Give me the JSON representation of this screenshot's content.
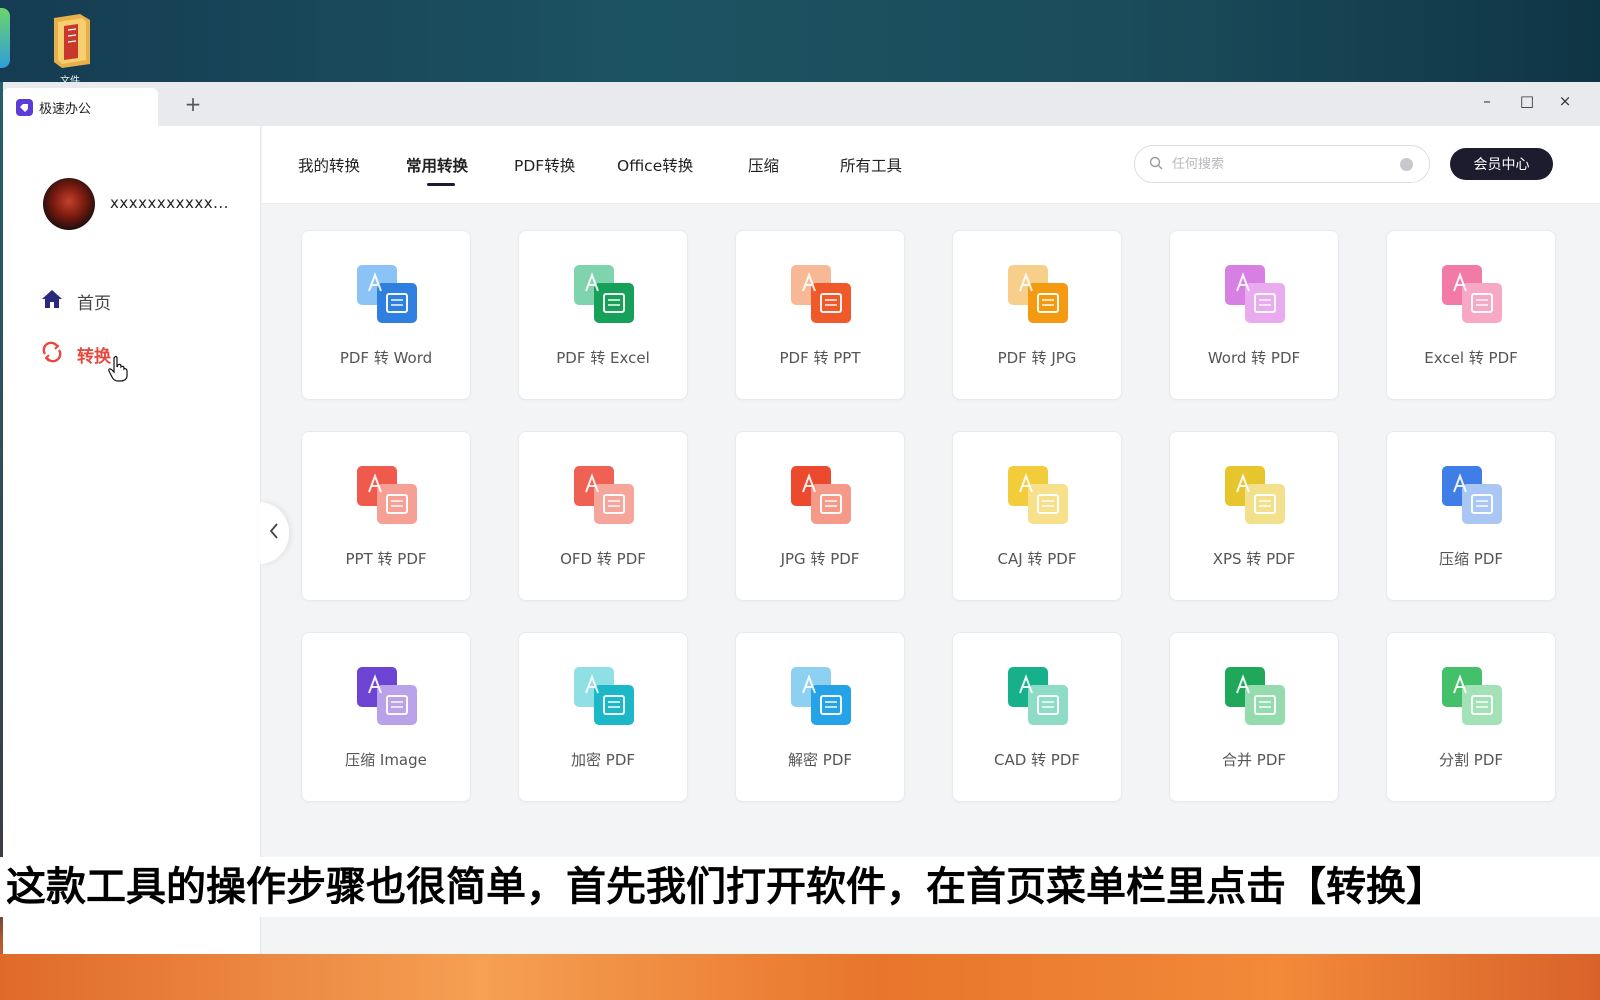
{
  "desktop": {
    "folder_label": "文件"
  },
  "window": {
    "tab_title": "极速办公",
    "new_tab": "+",
    "controls": {
      "minimize": "–",
      "maximize": "□",
      "close": "×"
    }
  },
  "sidebar": {
    "username": "xxxxxxxxxxx...",
    "items": [
      {
        "label": "首页",
        "icon": "home-icon",
        "color": "#2b2a7a"
      },
      {
        "label": "转换",
        "icon": "convert-icon",
        "color": "#e8493e",
        "active": true
      }
    ]
  },
  "topnav": {
    "tabs": [
      {
        "label": "我的转换"
      },
      {
        "label": "常用转换",
        "active": true
      },
      {
        "label": "PDF转换"
      },
      {
        "label": "Office转换"
      },
      {
        "label": "压缩"
      },
      {
        "label": "所有工具"
      }
    ],
    "search_placeholder": "任何搜索",
    "vip_button": "会员中心"
  },
  "tools": [
    {
      "label": "PDF 转 Word",
      "icon": "pdf-to-word-icon",
      "back": "#8cc3f7",
      "front": "#2f7fe0"
    },
    {
      "label": "PDF 转 Excel",
      "icon": "pdf-to-excel-icon",
      "back": "#7fd4ae",
      "front": "#16a05a"
    },
    {
      "label": "PDF 转 PPT",
      "icon": "pdf-to-ppt-icon",
      "back": "#f7b896",
      "front": "#f0592a"
    },
    {
      "label": "PDF 转 JPG",
      "icon": "pdf-to-jpg-icon",
      "back": "#f8cf8a",
      "front": "#f39a10"
    },
    {
      "label": "Word 转 PDF",
      "icon": "word-to-pdf-icon",
      "back": "#d77fe3",
      "front": "#eaaaf0"
    },
    {
      "label": "Excel 转 PDF",
      "icon": "excel-to-pdf-icon",
      "back": "#f27aa6",
      "front": "#f6a8c4"
    },
    {
      "label": "PPT 转 PDF",
      "icon": "ppt-to-pdf-icon",
      "back": "#f05a4c",
      "front": "#f6a095"
    },
    {
      "label": "OFD 转 PDF",
      "icon": "ofd-to-pdf-icon",
      "back": "#ef6154",
      "front": "#f6a59a"
    },
    {
      "label": "JPG 转 PDF",
      "icon": "jpg-to-pdf-icon",
      "back": "#eb4a2e",
      "front": "#f59a88"
    },
    {
      "label": "CAJ 转 PDF",
      "icon": "caj-to-pdf-icon",
      "back": "#f2cc3a",
      "front": "#f7e08a"
    },
    {
      "label": "XPS 转 PDF",
      "icon": "xps-to-pdf-icon",
      "back": "#e7c52d",
      "front": "#f3e08a"
    },
    {
      "label": "压缩 PDF",
      "icon": "compress-pdf-icon",
      "back": "#3e7ee6",
      "front": "#a9c6f4"
    },
    {
      "label": "压缩 Image",
      "icon": "compress-image-icon",
      "back": "#6d43d3",
      "front": "#b9a2ea"
    },
    {
      "label": "加密 PDF",
      "icon": "encrypt-pdf-icon",
      "back": "#8fe0e4",
      "front": "#1cb8c8"
    },
    {
      "label": "解密 PDF",
      "icon": "decrypt-pdf-icon",
      "back": "#8ed0f2",
      "front": "#26a2e6"
    },
    {
      "label": "CAD 转 PDF",
      "icon": "cad-to-pdf-icon",
      "back": "#16b08a",
      "front": "#8edbc6"
    },
    {
      "label": "合并 PDF",
      "icon": "merge-pdf-icon",
      "back": "#1fa85a",
      "front": "#94dcad"
    },
    {
      "label": "分割 PDF",
      "icon": "split-pdf-icon",
      "back": "#45c06a",
      "front": "#a3e2b6"
    }
  ],
  "subtitle": "这款工具的操作步骤也很简单，首先我们打开软件，在首页菜单栏里点击【转换】"
}
